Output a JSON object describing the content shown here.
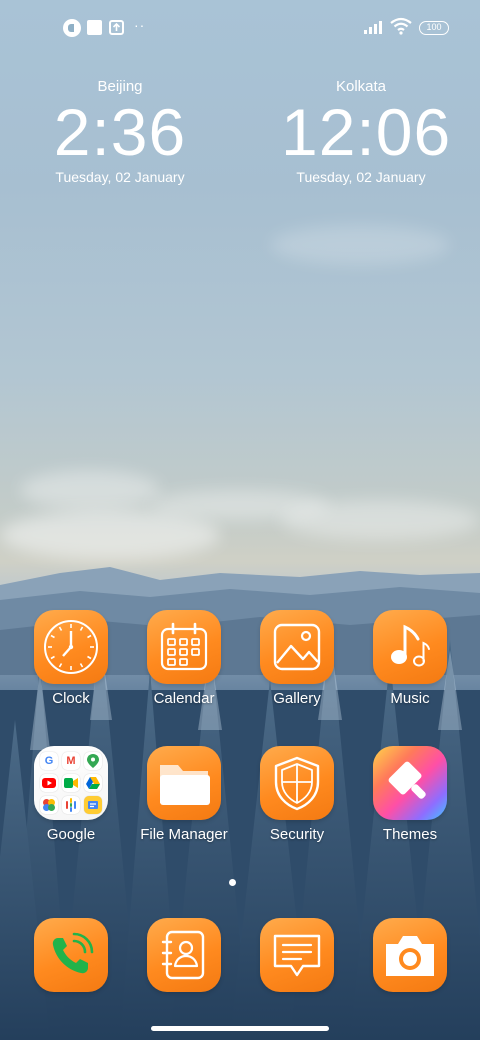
{
  "status_bar": {
    "battery": "100",
    "icons": [
      "app-notification-icon",
      "square-notification-icon",
      "upload-icon",
      "more-dots-icon",
      "signal-icon",
      "wifi-icon",
      "battery-icon"
    ]
  },
  "clocks": [
    {
      "city": "Beijing",
      "time": "2:36",
      "date": "Tuesday, 02 January"
    },
    {
      "city": "Kolkata",
      "time": "12:06",
      "date": "Tuesday, 02 January"
    }
  ],
  "apps": {
    "row1": [
      {
        "label": "Clock",
        "icon": "clock-icon"
      },
      {
        "label": "Calendar",
        "icon": "calendar-icon"
      },
      {
        "label": "Gallery",
        "icon": "gallery-icon"
      },
      {
        "label": "Music",
        "icon": "music-icon"
      }
    ],
    "row2": [
      {
        "label": "Google",
        "icon": "google-folder-icon"
      },
      {
        "label": "File Manager",
        "icon": "folder-icon"
      },
      {
        "label": "Security",
        "icon": "shield-icon"
      },
      {
        "label": "Themes",
        "icon": "themes-brush-icon"
      }
    ]
  },
  "dock": [
    {
      "icon": "phone-icon"
    },
    {
      "icon": "contacts-icon"
    },
    {
      "icon": "messages-icon"
    },
    {
      "icon": "camera-icon"
    }
  ],
  "colors": {
    "accent_orange": "#ff8a1f",
    "phone_green": "#22b34a"
  },
  "page_indicator": {
    "current": 1
  }
}
